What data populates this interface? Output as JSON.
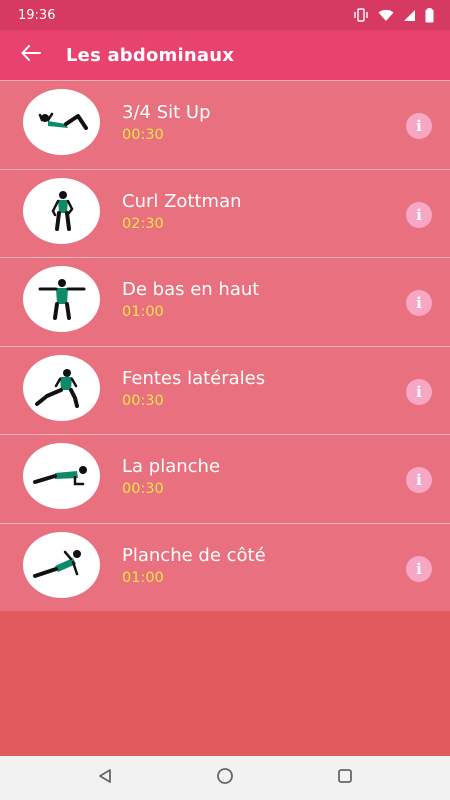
{
  "status_bar": {
    "time": "19:36"
  },
  "app_bar": {
    "title": "Les abdominaux",
    "back_icon": "arrow-left-icon"
  },
  "exercises": [
    {
      "name": "3/4 Sit Up",
      "duration": "00:30",
      "pose": "situp"
    },
    {
      "name": "Curl Zottman",
      "duration": "02:30",
      "pose": "curl"
    },
    {
      "name": "De bas en haut",
      "duration": "01:00",
      "pose": "arms"
    },
    {
      "name": "Fentes latérales",
      "duration": "00:30",
      "pose": "lunge"
    },
    {
      "name": "La planche",
      "duration": "00:30",
      "pose": "plank"
    },
    {
      "name": "Planche de côté",
      "duration": "01:00",
      "pose": "sideplank"
    }
  ],
  "colors": {
    "status_bar": "#d63a63",
    "app_bar": "#e8426e",
    "list_bg": "#e9707e",
    "page_bg": "#e05a5e",
    "duration_text": "#f6e24a",
    "info_button": "#f7a6c4"
  }
}
